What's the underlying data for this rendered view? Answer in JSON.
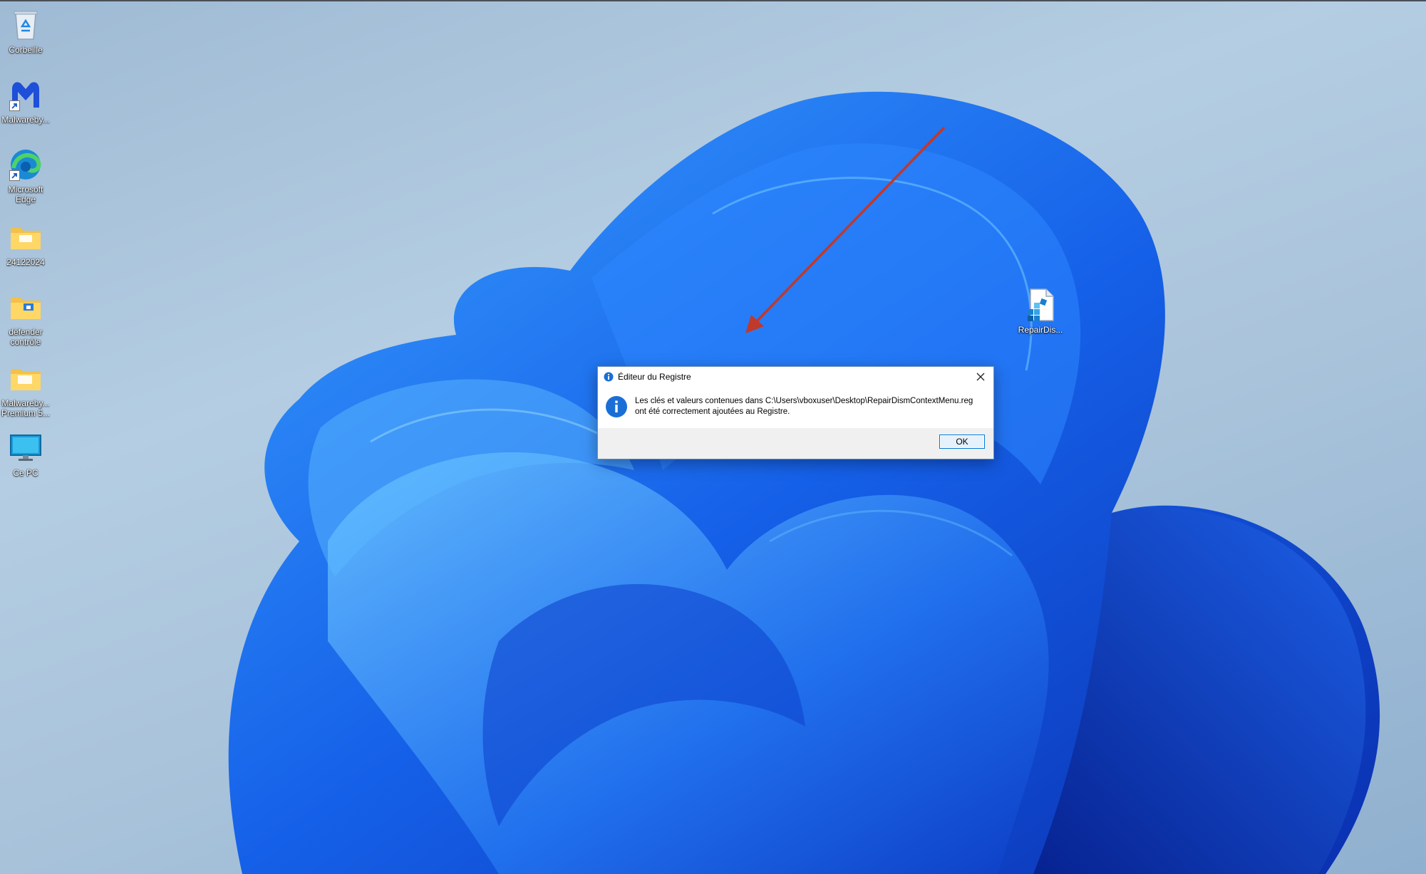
{
  "desktop": {
    "icons": [
      {
        "label": "Corbeille",
        "icon": "recycle-bin-icon"
      },
      {
        "label": "Malwareby...",
        "icon": "malwarebytes-icon"
      },
      {
        "label": "Microsoft Edge",
        "icon": "edge-icon"
      },
      {
        "label": "24122024",
        "icon": "folder-icon"
      },
      {
        "label": "défender contrôle",
        "icon": "folder-shield-icon"
      },
      {
        "label": "Malwareby... Premium 5...",
        "icon": "folder-icon"
      },
      {
        "label": "Ce PC",
        "icon": "monitor-icon"
      }
    ],
    "file_icon": {
      "label": "RepairDis...",
      "icon": "registry-file-icon"
    }
  },
  "dialog": {
    "title": "Éditeur du Registre",
    "message_line1": "Les clés et valeurs contenues dans C:\\Users\\vboxuser\\Desktop\\RepairDismContextMenu.reg",
    "message_line2": "ont été correctement ajoutées au Registre.",
    "ok_label": "OK"
  },
  "colors": {
    "wallpaper_blue": "#1a5fe0",
    "annotation_arrow": "#c0392b",
    "dialog_accent": "#0078d4"
  }
}
